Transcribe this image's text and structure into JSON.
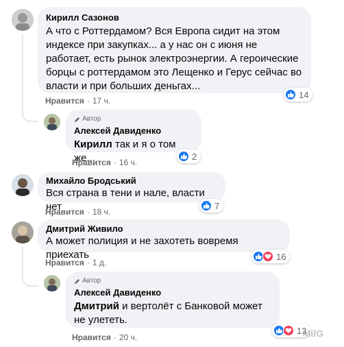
{
  "comments": [
    {
      "author": "Кирилл Сазонов",
      "text": "А что с Роттердамом? Вся Европа сидит на этом индексе при закупках... а у нас он с июня не работает, есть рынок электроэнергии. А героические борцы с роттердамом это Лещенко и Герус сейчас во власти и при больших деньгах...",
      "like_label": "Нравится",
      "time": "17 ч.",
      "reaction_count": "14"
    },
    {
      "badge": "Автор",
      "author": "Алексей Давиденко",
      "mention": "Кирилл",
      "text": "так и я о том же...",
      "like_label": "Нравится",
      "time": "16 ч.",
      "reaction_count": "2"
    },
    {
      "author": "Михайло Бродський",
      "text": "Вся страна в тени и нале, власти нет",
      "like_label": "Нравится",
      "time": "18 ч.",
      "reaction_count": "7"
    },
    {
      "author": "Дмитрий Живило",
      "text": "А может полиция и не захотеть вовремя приехать",
      "like_label": "Нравится",
      "time": "1 д.",
      "reaction_count": "16"
    },
    {
      "badge": "Автор",
      "author": "Алексей Давиденко",
      "mention": "Дмитрий",
      "text": "и вертолёт с Банковой может не улететь.",
      "like_label": "Нравится",
      "time": "20 ч.",
      "reaction_count": "13"
    }
  ],
  "watermark": "MilG",
  "colors": {
    "like_blue": "#1877f2",
    "love_red": "#f33e58",
    "bubble": "#f0f2f5",
    "meta": "#65676b"
  }
}
